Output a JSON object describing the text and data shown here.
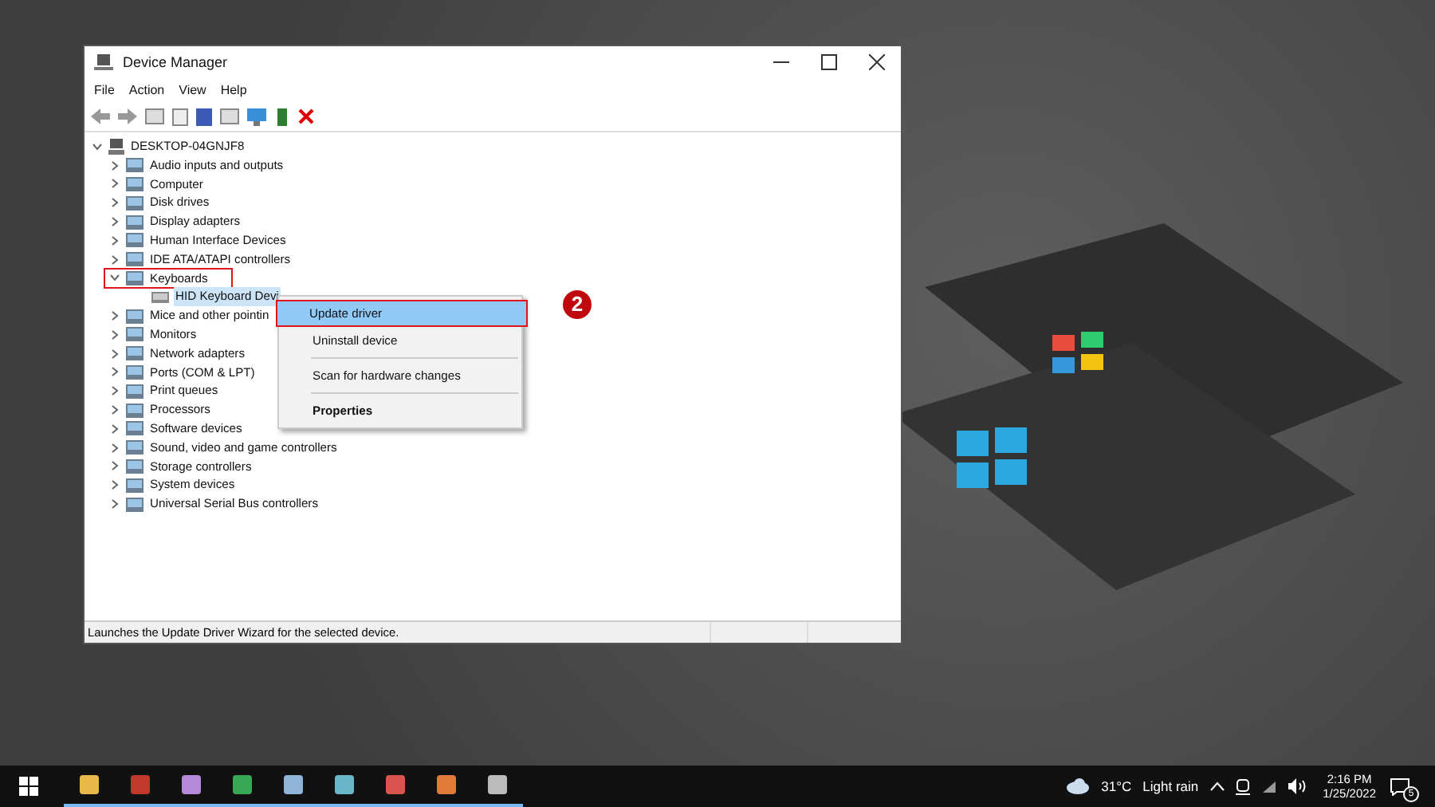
{
  "window": {
    "title": "Device Manager"
  },
  "menu_bar": [
    "File",
    "Action",
    "View",
    "Help"
  ],
  "tree": {
    "label": "DESKTOP-04GNJF8",
    "expanded": true,
    "children": [
      {
        "label": "Audio inputs and outputs",
        "expanded": false
      },
      {
        "label": "Computer",
        "expanded": false
      },
      {
        "label": "Disk drives",
        "expanded": false
      },
      {
        "label": "Display adapters",
        "expanded": false
      },
      {
        "label": "Human Interface Devices",
        "expanded": false
      },
      {
        "label": "IDE ATA/ATAPI controllers",
        "expanded": false
      },
      {
        "label": "Keyboards",
        "expanded": true,
        "highlighted": true,
        "children": [
          {
            "label": "HID Keyboard Devi",
            "selected": true
          }
        ]
      },
      {
        "label": "Mice and other pointin",
        "expanded": false
      },
      {
        "label": "Monitors",
        "expanded": false
      },
      {
        "label": "Network adapters",
        "expanded": false
      },
      {
        "label": "Ports (COM & LPT)",
        "expanded": false
      },
      {
        "label": "Print queues",
        "expanded": false
      },
      {
        "label": "Processors",
        "expanded": false
      },
      {
        "label": "Software devices",
        "expanded": false
      },
      {
        "label": "Sound, video and game controllers",
        "expanded": false
      },
      {
        "label": "Storage controllers",
        "expanded": false
      },
      {
        "label": "System devices",
        "expanded": false
      },
      {
        "label": "Universal Serial Bus controllers",
        "expanded": false
      }
    ]
  },
  "context_menu": [
    {
      "label": "Update driver",
      "selected": true,
      "bold": false,
      "separator_before": false,
      "highlighted": true
    },
    {
      "label": "Uninstall device",
      "selected": false,
      "bold": false,
      "separator_before": false,
      "highlighted": false
    },
    {
      "label": "Scan for hardware changes",
      "selected": false,
      "bold": false,
      "separator_before": true,
      "highlighted": false
    },
    {
      "label": "Properties",
      "selected": false,
      "bold": true,
      "separator_before": true,
      "highlighted": false
    }
  ],
  "step_badge": "2",
  "status_bar": "Launches the Update Driver Wizard for the selected device.",
  "taskbar": {
    "weather_temp": "31°C",
    "weather_text": "Light rain",
    "time": "2:16 PM",
    "date": "1/25/2022",
    "notification_count": "5"
  }
}
